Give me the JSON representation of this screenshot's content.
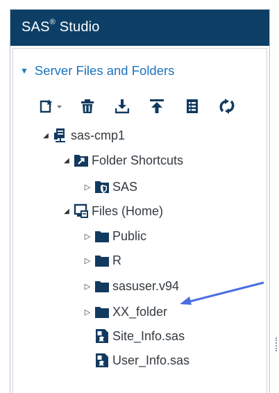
{
  "app": {
    "title": "SAS",
    "title_sup": "®",
    "title_rest": " Studio"
  },
  "panel": {
    "section_label": "Server Files and Folders",
    "toolbar_icons": [
      "new-item-icon",
      "delete-icon",
      "download-icon",
      "upload-icon",
      "properties-icon",
      "refresh-icon"
    ]
  },
  "tree": {
    "server": "sas-cmp1",
    "folder_shortcuts": "Folder Shortcuts",
    "shortcut_sas": "SAS",
    "files_home": "Files (Home)",
    "public": "Public",
    "r": "R",
    "sasuser": "sasuser.v94",
    "xx_folder": "XX_folder",
    "site_info": "Site_Info.sas",
    "user_info": "User_Info.sas"
  },
  "colors": {
    "titlebar": "#0d3f66",
    "accent": "#1a73be",
    "icon_navy": "#123a5f",
    "annotation_arrow": "#4a6ee0"
  }
}
